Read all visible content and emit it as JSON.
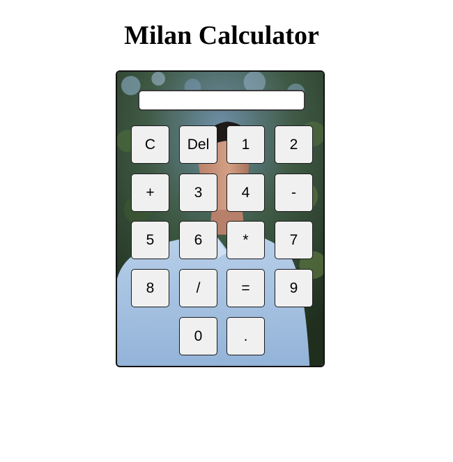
{
  "page": {
    "title": "Milan Calculator"
  },
  "display": {
    "value": "",
    "placeholder": ""
  },
  "keys": {
    "clear": "C",
    "delete": "Del",
    "one": "1",
    "two": "2",
    "plus": "+",
    "three": "3",
    "four": "4",
    "minus": "-",
    "five": "5",
    "six": "6",
    "multiply": "*",
    "seven": "7",
    "eight": "8",
    "divide": "/",
    "equals": "=",
    "nine": "9",
    "zero": "0",
    "decimal": "."
  },
  "colors": {
    "key_background": "#f0f0f0",
    "key_border": "#1a1a1a",
    "shirt": "#a9c4e2",
    "foliage": "#2f4a2a",
    "skin": "#c99479"
  }
}
